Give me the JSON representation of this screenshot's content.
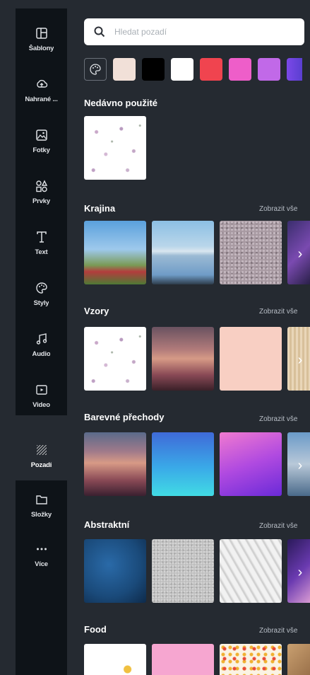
{
  "sidebar": {
    "items": [
      {
        "label": "Šablony",
        "icon": "templates-icon"
      },
      {
        "label": "Nahrané ...",
        "icon": "upload-cloud-icon"
      },
      {
        "label": "Fotky",
        "icon": "photo-icon"
      },
      {
        "label": "Prvky",
        "icon": "elements-icon"
      },
      {
        "label": "Text",
        "icon": "text-icon"
      },
      {
        "label": "Styly",
        "icon": "palette-icon"
      },
      {
        "label": "Audio",
        "icon": "music-note-icon"
      },
      {
        "label": "Video",
        "icon": "video-icon"
      },
      {
        "label": "Pozadí",
        "icon": "background-pattern-icon"
      },
      {
        "label": "Složky",
        "icon": "folder-icon"
      },
      {
        "label": "Více",
        "icon": "more-dots-icon"
      }
    ],
    "active": "Pozadí"
  },
  "search": {
    "placeholder": "Hledat pozadí"
  },
  "swatches": [
    "#f1e0d8",
    "#000000",
    "#ffffff",
    "#f0444f",
    "#ee5ec9",
    "#c169e8",
    "#7b48e8"
  ],
  "colors": {
    "panel_bg": "#252a31",
    "sidebar_bg": "#0e1318",
    "text": "#ffffff",
    "link": "#b8bec6"
  },
  "sections": {
    "recent": {
      "title": "Nedávno použité"
    },
    "landscape": {
      "title": "Krajina",
      "link": "Zobrazit vše"
    },
    "patterns": {
      "title": "Vzory",
      "link": "Zobrazit vše"
    },
    "gradients": {
      "title": "Barevné přechody",
      "link": "Zobrazit vše"
    },
    "abstract": {
      "title": "Abstraktní",
      "link": "Zobrazit vše"
    },
    "food": {
      "title": "Food",
      "link": "Zobrazit vše"
    }
  }
}
